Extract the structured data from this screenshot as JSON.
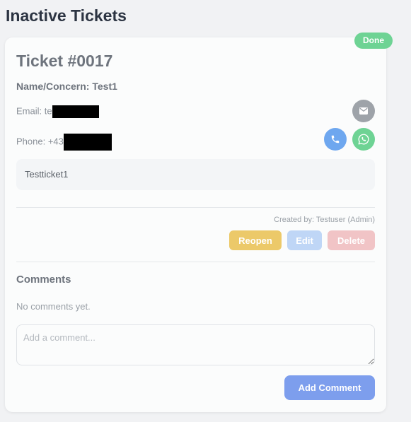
{
  "page": {
    "title": "Inactive Tickets"
  },
  "ticket": {
    "status": "Done",
    "number": "Ticket #0017",
    "concern": "Name/Concern: Test1",
    "email_prefix": "Email: te",
    "phone_prefix": "Phone: +43",
    "description": "Testticket1",
    "created_by": "Created by: Testuser (Admin)"
  },
  "actions": {
    "reopen": "Reopen",
    "edit": "Edit",
    "delete": "Delete"
  },
  "contact_icons": {
    "email": "envelope-icon",
    "call": "phone-icon",
    "whatsapp": "whatsapp-icon"
  },
  "comments": {
    "heading": "Comments",
    "empty_text": "No comments yet.",
    "placeholder": "Add a comment...",
    "submit_label": "Add Comment"
  },
  "colors": {
    "done_badge": "#6ed394",
    "reopen": "#ecc969",
    "edit": "#bfd6f6",
    "delete": "#f1c4c6",
    "add_comment": "#7d9eed"
  }
}
